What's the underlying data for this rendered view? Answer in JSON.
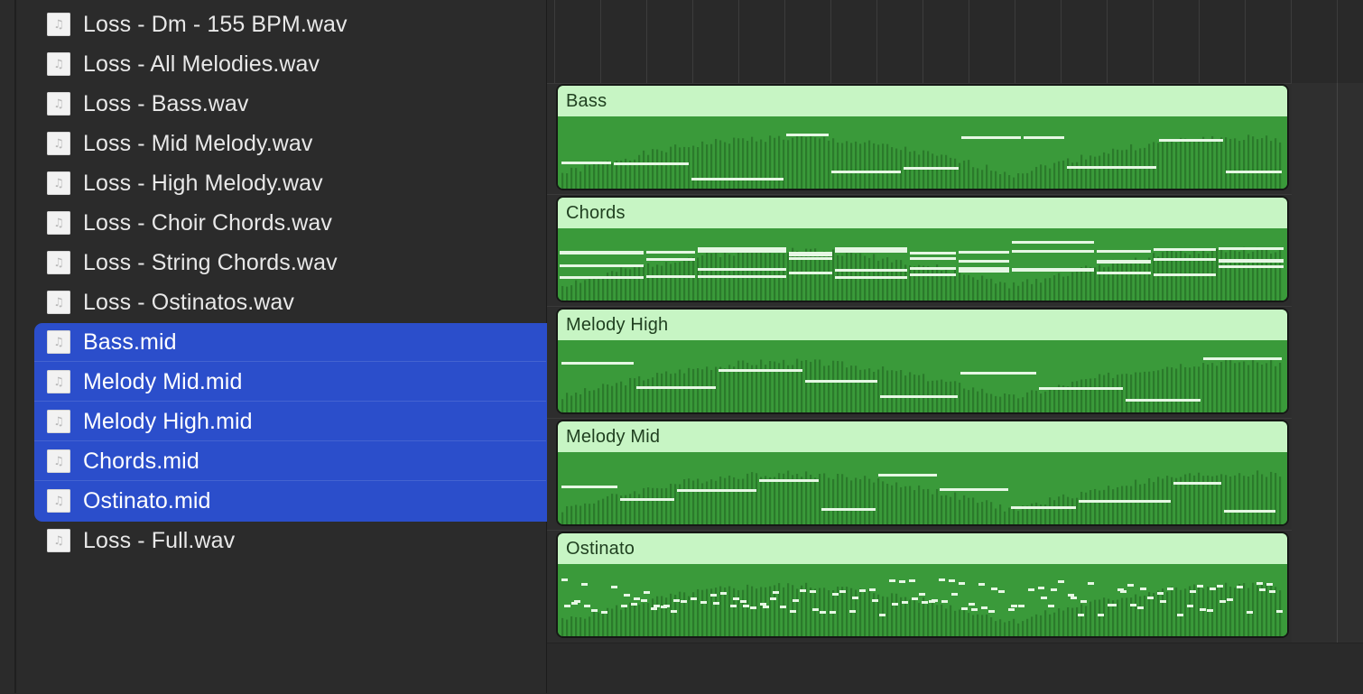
{
  "browser": {
    "icon": "music-note-icon",
    "files": [
      {
        "name": "Loss - Dm - 155 BPM.wav",
        "selected": false
      },
      {
        "name": "Loss - All Melodies.wav",
        "selected": false
      },
      {
        "name": "Loss - Bass.wav",
        "selected": false
      },
      {
        "name": "Loss - Mid Melody.wav",
        "selected": false
      },
      {
        "name": "Loss - High Melody.wav",
        "selected": false
      },
      {
        "name": "Loss - Choir Chords.wav",
        "selected": false
      },
      {
        "name": "Loss - String Chords.wav",
        "selected": false
      },
      {
        "name": "Loss - Ostinatos.wav",
        "selected": false
      },
      {
        "name": "Bass.mid",
        "selected": true
      },
      {
        "name": "Melody Mid.mid",
        "selected": true
      },
      {
        "name": "Melody High.mid",
        "selected": true
      },
      {
        "name": "Chords.mid",
        "selected": true
      },
      {
        "name": "Ostinato.mid",
        "selected": true
      },
      {
        "name": "Loss - Full.wav",
        "selected": false
      }
    ],
    "selection_color": "#2b4ecb"
  },
  "arrange": {
    "region_color": "#3a9a3a",
    "header_color": "#c7f5c4",
    "regions": [
      {
        "name": "Bass",
        "pattern": "melodic"
      },
      {
        "name": "Chords",
        "pattern": "chords"
      },
      {
        "name": "Melody High",
        "pattern": "melodic"
      },
      {
        "name": "Melody Mid",
        "pattern": "melodic"
      },
      {
        "name": "Ostinato",
        "pattern": "ostinato"
      }
    ]
  }
}
